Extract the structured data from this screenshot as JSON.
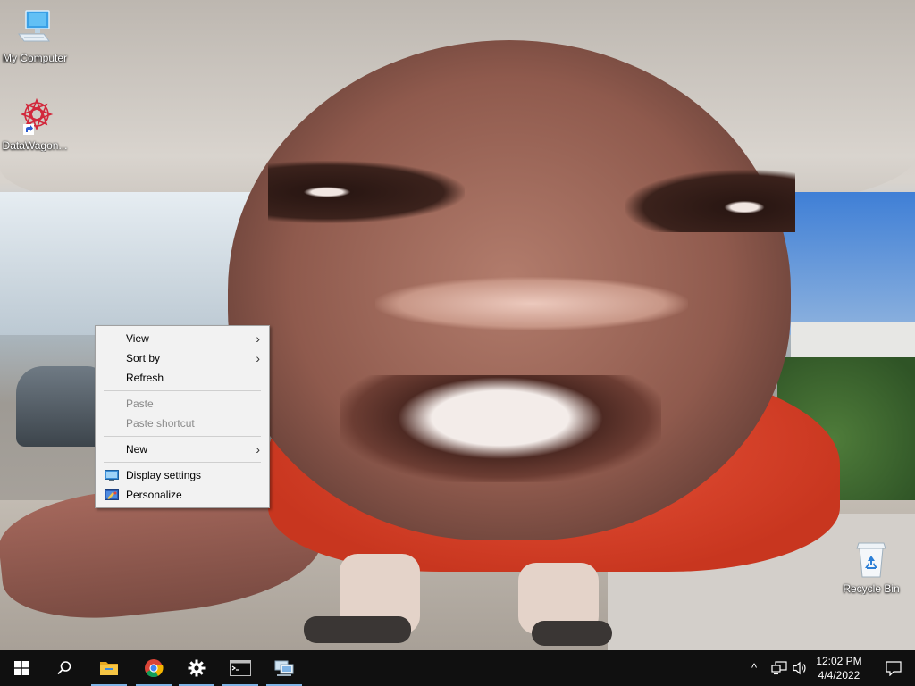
{
  "desktop": {
    "icons": [
      {
        "label": "My Computer",
        "icon": "computer-icon"
      },
      {
        "label": "DataWagon...",
        "icon": "datawagon-icon"
      },
      {
        "label": "Recycle Bin",
        "icon": "recycle-bin-icon"
      }
    ]
  },
  "context_menu": {
    "items": [
      {
        "label": "View",
        "submenu": true
      },
      {
        "label": "Sort by",
        "submenu": true
      },
      {
        "label": "Refresh"
      },
      {
        "label": "Paste",
        "disabled": true
      },
      {
        "label": "Paste shortcut",
        "disabled": true
      },
      {
        "label": "New",
        "submenu": true
      },
      {
        "label": "Display settings",
        "icon": "display-settings-icon"
      },
      {
        "label": "Personalize",
        "icon": "personalize-icon"
      }
    ],
    "submenu_arrow": "›"
  },
  "taskbar": {
    "buttons": [
      {
        "name": "start-button",
        "icon": "windows-logo-icon"
      },
      {
        "name": "search-button",
        "icon": "search-icon"
      },
      {
        "name": "file-explorer-button",
        "icon": "folder-icon",
        "running": true
      },
      {
        "name": "chrome-button",
        "icon": "chrome-icon",
        "running": true
      },
      {
        "name": "settings-button",
        "icon": "gear-icon",
        "running": true
      },
      {
        "name": "command-prompt-button",
        "icon": "cmd-icon",
        "running": true
      },
      {
        "name": "network-app-button",
        "icon": "network-computer-icon",
        "running": true
      }
    ],
    "tray": {
      "chevron": "^",
      "time": "12:02 PM",
      "date": "4/4/2022"
    }
  },
  "colors": {
    "taskbar": "#101010",
    "menu_bg": "#f2f2f2",
    "running_indicator": "#7fb4e6"
  }
}
